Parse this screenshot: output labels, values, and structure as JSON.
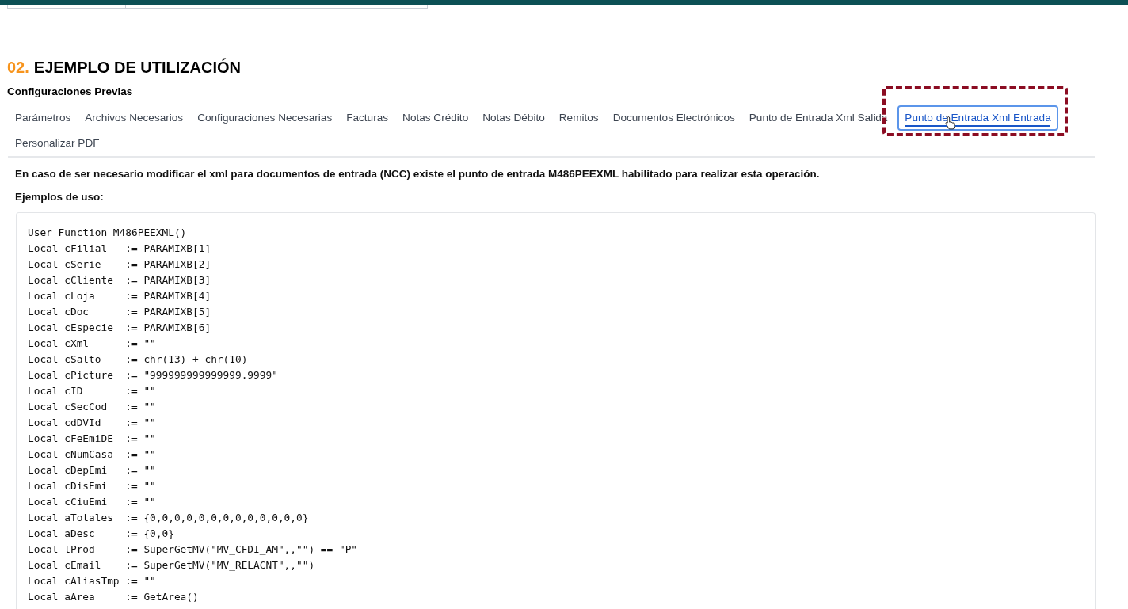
{
  "section": {
    "number": "02.",
    "title": "EJEMPLO DE UTILIZACIÓN",
    "subtitle": "Configuraciones Previas"
  },
  "tabs": [
    {
      "label": "Parámetros",
      "selected": false
    },
    {
      "label": "Archivos Necesarios",
      "selected": false
    },
    {
      "label": "Configuraciones Necesarias",
      "selected": false
    },
    {
      "label": "Facturas",
      "selected": false
    },
    {
      "label": "Notas Crédito",
      "selected": false
    },
    {
      "label": "Notas Débito",
      "selected": false
    },
    {
      "label": "Remitos",
      "selected": false
    },
    {
      "label": "Documentos Electrónicos",
      "selected": false
    },
    {
      "label": "Punto de Entrada Xml Salida",
      "selected": false
    },
    {
      "label": "Punto de Entrada Xml Entrada",
      "selected": true,
      "highlighted": true
    },
    {
      "label": "Personalizar PDF",
      "selected": false
    }
  ],
  "description": "En caso de ser necesario modificar el xml para documentos de entrada (NCC) existe el punto de entrada M486PEEXML habilitado para realizar esta operación.",
  "examples_label": "Ejemplos de uso:",
  "code_lines": [
    "User Function M486PEEXML()",
    "Local cFilial   := PARAMIXB[1]",
    "Local cSerie    := PARAMIXB[2]",
    "Local cCliente  := PARAMIXB[3]",
    "Local cLoja     := PARAMIXB[4]",
    "Local cDoc      := PARAMIXB[5]",
    "Local cEspecie  := PARAMIXB[6]",
    "Local cXml      := \"\"",
    "Local cSalto    := chr(13) + chr(10)",
    "Local cPicture  := \"999999999999999.9999\"",
    "Local cID       := \"\"",
    "Local cSecCod   := \"\"",
    "Local cdDVId    := \"\"",
    "Local cFeEmiDE  := \"\"",
    "Local cNumCasa  := \"\"",
    "Local cDepEmi   := \"\"",
    "Local cDisEmi   := \"\"",
    "Local cCiuEmi   := \"\"",
    "Local aTotales  := {0,0,0,0,0,0,0,0,0,0,0,0,0}",
    "Local aDesc     := {0,0}",
    "Local lProd     := SuperGetMV(\"MV_CFDI_AM\",,\"\") == \"P\"",
    "Local cEmail    := SuperGetMV(\"MV_RELACNT\",,\"\")",
    "Local cAliasTmp := \"\"",
    "Local aArea     := GetArea()"
  ]
}
